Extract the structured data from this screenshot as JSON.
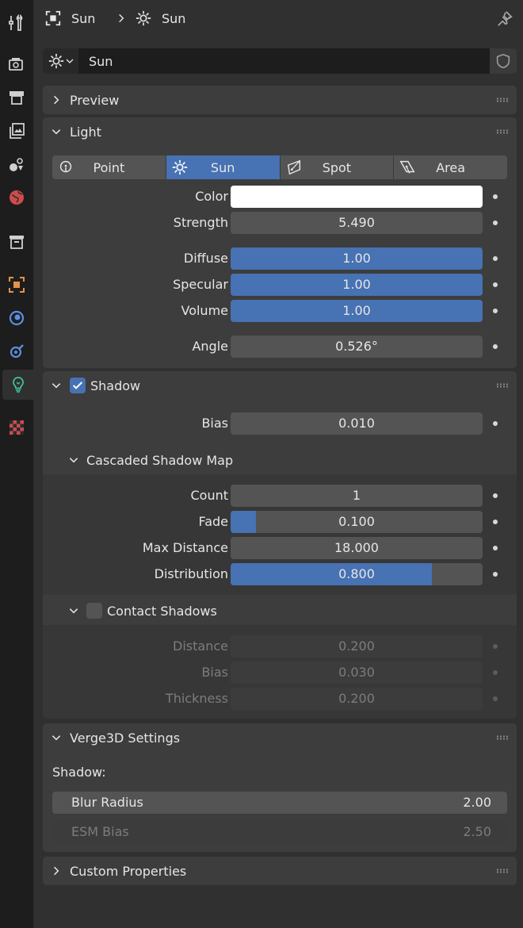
{
  "breadcrumb": {
    "object": "Sun",
    "data": "Sun"
  },
  "datablock": {
    "name": "Sun"
  },
  "tabs": [
    "tool-icon",
    "render-icon",
    "output-icon",
    "view-layer-icon",
    "scene-icon",
    "world-icon",
    "collection-icon",
    "object-icon",
    "physics-icon",
    "constraints-icon",
    "light-data-icon",
    "texture-icon"
  ],
  "preview": {
    "title": "Preview"
  },
  "light": {
    "title": "Light",
    "types": [
      "Point",
      "Sun",
      "Spot",
      "Area"
    ],
    "active_type": "Sun",
    "color_label": "Color",
    "color_value": "#ffffff",
    "strength_label": "Strength",
    "strength": "5.490",
    "diffuse_label": "Diffuse",
    "diffuse": "1.00",
    "specular_label": "Specular",
    "specular": "1.00",
    "volume_label": "Volume",
    "volume": "1.00",
    "angle_label": "Angle",
    "angle": "0.526°"
  },
  "shadow": {
    "title": "Shadow",
    "enabled": true,
    "bias_label": "Bias",
    "bias": "0.010",
    "csm": {
      "title": "Cascaded Shadow Map",
      "count_label": "Count",
      "count": "1",
      "fade_label": "Fade",
      "fade": "0.100",
      "fade_fraction": 0.1,
      "max_distance_label": "Max Distance",
      "max_distance": "18.000",
      "distribution_label": "Distribution",
      "distribution": "0.800",
      "distribution_fraction": 0.8
    },
    "contact": {
      "title": "Contact Shadows",
      "enabled": false,
      "distance_label": "Distance",
      "distance": "0.200",
      "bias_label": "Bias",
      "bias": "0.030",
      "thickness_label": "Thickness",
      "thickness": "0.200"
    }
  },
  "verge": {
    "title": "Verge3D Settings",
    "shadow_label": "Shadow:",
    "blur_radius_label": "Blur Radius",
    "blur_radius": "2.00",
    "esm_bias_label": "ESM Bias",
    "esm_bias": "2.50"
  },
  "custom": {
    "title": "Custom Properties"
  },
  "colors": {
    "accent": "#4772b3",
    "panel": "#3d3d3d",
    "field": "#545454",
    "background": "#303030",
    "tabstrip": "#1d1d1d"
  }
}
